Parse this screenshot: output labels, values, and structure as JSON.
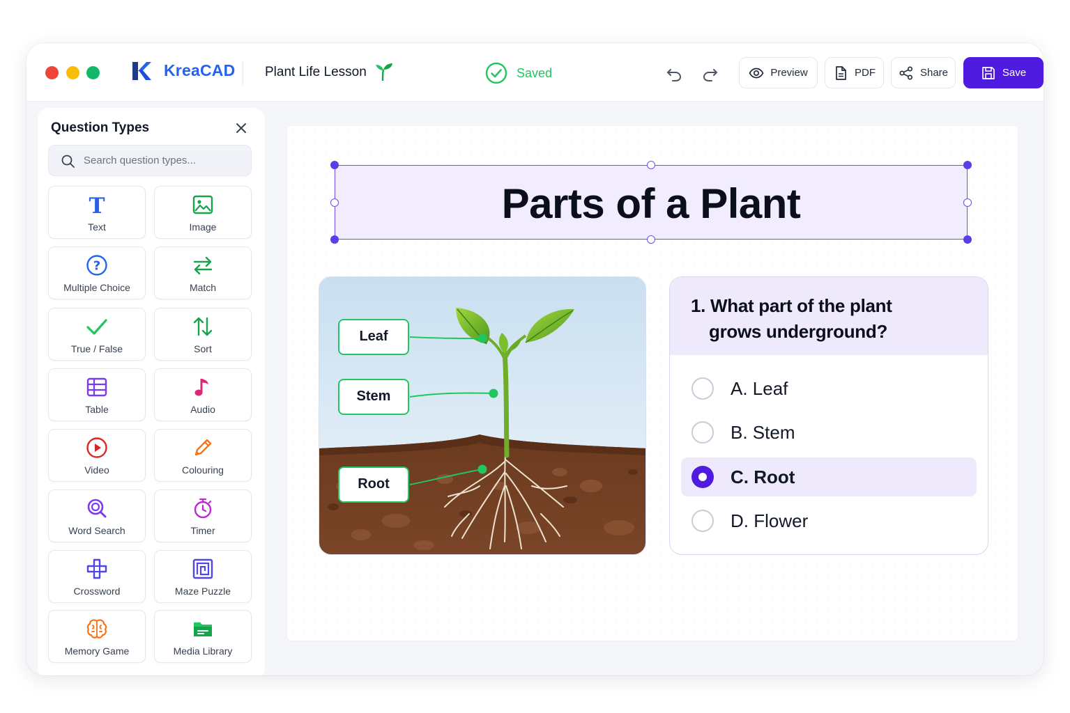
{
  "app": {
    "name": "KreaCAD",
    "document_title": "Plant Life Lesson",
    "status": "Saved",
    "accent_color": "#4f1be0",
    "success_color": "#22c55e"
  },
  "toolbar": {
    "preview_label": "Preview",
    "pdf_label": "PDF",
    "share_label": "Share",
    "save_label": "Save"
  },
  "sidebar": {
    "title": "Question Types",
    "search_placeholder": "Search question types...",
    "items": [
      {
        "label": "Text",
        "icon": "text-icon"
      },
      {
        "label": "Image",
        "icon": "image-icon"
      },
      {
        "label": "Multiple Choice",
        "icon": "question-circle-icon"
      },
      {
        "label": "Match",
        "icon": "swap-arrows-icon"
      },
      {
        "label": "True / False",
        "icon": "check-icon"
      },
      {
        "label": "Sort",
        "icon": "sort-arrows-icon"
      },
      {
        "label": "Table",
        "icon": "table-icon"
      },
      {
        "label": "Audio",
        "icon": "music-note-icon"
      },
      {
        "label": "Video",
        "icon": "play-circle-icon"
      },
      {
        "label": "Colouring",
        "icon": "pencil-icon"
      },
      {
        "label": "Word Search",
        "icon": "magnifier-icon"
      },
      {
        "label": "Timer",
        "icon": "stopwatch-icon"
      },
      {
        "label": "Crossword",
        "icon": "crossword-icon"
      },
      {
        "label": "Maze Puzzle",
        "icon": "maze-icon"
      },
      {
        "label": "Memory Game",
        "icon": "brain-icon"
      },
      {
        "label": "Media Library",
        "icon": "folder-icon"
      }
    ]
  },
  "canvas": {
    "title": "Parts of a Plant",
    "diagram_labels": {
      "leaf": "Leaf",
      "stem": "Stem",
      "root": "Root"
    },
    "question": {
      "line1": "1. What part of the plant",
      "line2": "grows underground?",
      "options": [
        {
          "text": "A. Leaf",
          "selected": false
        },
        {
          "text": "B. Stem",
          "selected": false
        },
        {
          "text": "C. Root",
          "selected": true
        },
        {
          "text": "D. Flower",
          "selected": false
        }
      ]
    }
  }
}
